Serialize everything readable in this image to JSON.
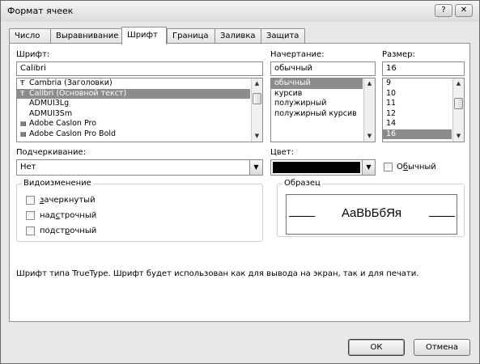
{
  "window": {
    "title": "Формат ячеек",
    "help_button": "?",
    "close_button": "✕"
  },
  "tabs": [
    {
      "label": "Число",
      "active": false
    },
    {
      "label": "Выравнивание",
      "active": false
    },
    {
      "label": "Шрифт",
      "active": true
    },
    {
      "label": "Граница",
      "active": false
    },
    {
      "label": "Заливка",
      "active": false
    },
    {
      "label": "Защита",
      "active": false
    }
  ],
  "font": {
    "label": "Шрифт:",
    "value": "Calibri",
    "list": [
      {
        "icon": "truetype-icon",
        "glyph": "Ŧ",
        "label": "Cambria (Заголовки)",
        "selected": false
      },
      {
        "icon": "truetype-icon",
        "glyph": "Ŧ",
        "label": "Calibri (Основной текст)",
        "selected": true
      },
      {
        "icon": "",
        "glyph": "",
        "label": "ADMUI3Lg",
        "selected": false
      },
      {
        "icon": "",
        "glyph": "",
        "label": "ADMUI3Sm",
        "selected": false
      },
      {
        "icon": "printer-font-icon",
        "glyph": "▤",
        "label": "Adobe Caslon Pro",
        "selected": false
      },
      {
        "icon": "printer-font-icon",
        "glyph": "▤",
        "label": "Adobe Caslon Pro Bold",
        "selected": false
      }
    ]
  },
  "style": {
    "label": "Начертание:",
    "value": "обычный",
    "list": [
      {
        "label": "обычный",
        "selected": true
      },
      {
        "label": "курсив",
        "selected": false
      },
      {
        "label": "полужирный",
        "selected": false
      },
      {
        "label": "полужирный курсив",
        "selected": false
      }
    ]
  },
  "size": {
    "label": "Размер:",
    "value": "16",
    "list": [
      {
        "label": "9",
        "selected": false
      },
      {
        "label": "10",
        "selected": false
      },
      {
        "label": "11",
        "selected": false
      },
      {
        "label": "12",
        "selected": false
      },
      {
        "label": "14",
        "selected": false
      },
      {
        "label": "16",
        "selected": true
      }
    ]
  },
  "underline": {
    "label": "Подчеркивание:",
    "value": "Нет"
  },
  "color": {
    "label": "Цвет:",
    "swatch": "#000000",
    "normal_label": "Обычный"
  },
  "effects": {
    "title": "Видоизменение",
    "items": [
      {
        "label": "зачеркнутый",
        "checked": false
      },
      {
        "label": "надстрочный",
        "checked": false
      },
      {
        "label": "подстрочный",
        "checked": false
      }
    ]
  },
  "preview": {
    "title": "Образец",
    "sample": "AaBbБбЯя"
  },
  "info_text": "Шрифт типа TrueType. Шрифт будет использован как для вывода на экран, так и для печати.",
  "buttons": {
    "ok": "ОК",
    "cancel": "Отмена"
  }
}
